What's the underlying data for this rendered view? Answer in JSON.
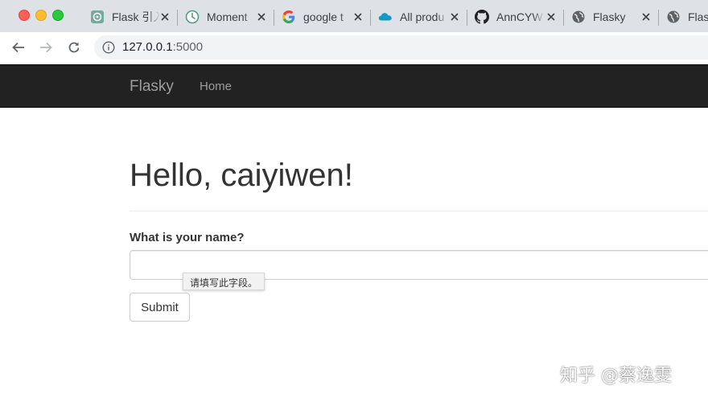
{
  "browser": {
    "tabs": [
      {
        "title": "Flask 引入",
        "icon": "chatgpt-icon"
      },
      {
        "title": "Moment",
        "icon": "clock-icon"
      },
      {
        "title": "google t",
        "icon": "google-icon"
      },
      {
        "title": "All produ",
        "icon": "cloud-icon"
      },
      {
        "title": "AnnCYW",
        "icon": "github-icon"
      },
      {
        "title": "Flasky",
        "icon": "globe-icon"
      },
      {
        "title": "Flasky",
        "icon": "globe-icon"
      }
    ],
    "url_host": "127.0.0.1",
    "url_port": ":5000"
  },
  "navbar": {
    "brand": "Flasky",
    "home": "Home",
    "bg_color": "#222222",
    "link_color": "#9d9d9d"
  },
  "main": {
    "heading": "Hello, caiyiwen!",
    "form": {
      "label": "What is your name?",
      "name_value": "",
      "validation_tooltip": "请填写此字段。",
      "submit_label": "Submit"
    }
  },
  "watermark": "知乎 @蔡逸雯"
}
